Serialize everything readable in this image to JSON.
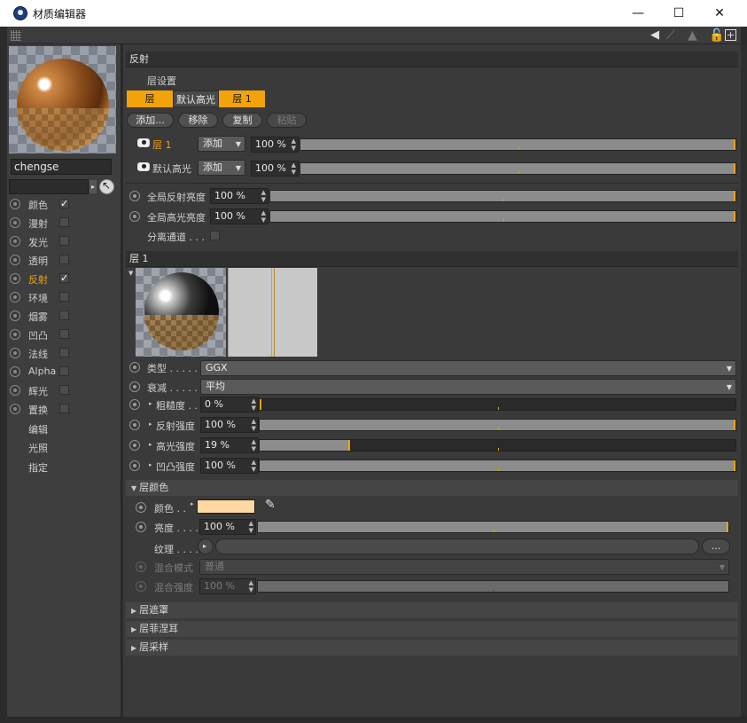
{
  "window": {
    "title": "材质编辑器",
    "minimize": "—",
    "maximize": "☐",
    "close": "✕"
  },
  "colors": {
    "accent": "#f3a30a",
    "layer_color": "#ffd8a0"
  },
  "left": {
    "material_name": "chengse",
    "channels": [
      {
        "label": "颜色",
        "checked": true,
        "active": false
      },
      {
        "label": "漫射",
        "checked": false,
        "active": false
      },
      {
        "label": "发光",
        "checked": false,
        "active": false
      },
      {
        "label": "透明",
        "checked": false,
        "active": false
      },
      {
        "label": "反射",
        "checked": true,
        "active": true
      },
      {
        "label": "环境",
        "checked": false,
        "active": false
      },
      {
        "label": "烟雾",
        "checked": false,
        "active": false
      },
      {
        "label": "凹凸",
        "checked": false,
        "active": false
      },
      {
        "label": "法线",
        "checked": false,
        "active": false
      },
      {
        "label": "Alpha",
        "checked": false,
        "active": false
      },
      {
        "label": "辉光",
        "checked": false,
        "active": false
      },
      {
        "label": "置换",
        "checked": false,
        "active": false
      }
    ],
    "extras": [
      "编辑",
      "光照",
      "指定"
    ]
  },
  "reflect": {
    "section_title": "反射",
    "layer_settings": "层设置",
    "tabs": [
      "层",
      "默认高光",
      "层 1"
    ],
    "buttons": {
      "add": "添加...",
      "remove": "移除",
      "copy": "复制",
      "paste": "粘贴"
    },
    "layers": [
      {
        "name": "层 1",
        "mode": "添加",
        "value": "100 %",
        "fill": 1.0
      },
      {
        "name": "默认高光",
        "mode": "添加",
        "value": "100 %",
        "fill": 1.0
      }
    ],
    "global_reflect_label": "全局反射亮度",
    "global_reflect_value": "100 %",
    "global_spec_label": "全局高光亮度",
    "global_spec_value": "100 %",
    "separate_pass_label": "分离通道 . . ."
  },
  "layer1": {
    "section_title": "层 1",
    "type_label": "类型 . . . . . .",
    "type_value": "GGX",
    "atten_label": "衰减 . . . . . . .",
    "atten_value": "平均",
    "params": [
      {
        "label": "粗糙度 . .",
        "value": "0 %",
        "fill": 0.0
      },
      {
        "label": "反射强度",
        "value": "100 %",
        "fill": 1.0
      },
      {
        "label": "高光强度",
        "value": "19 %",
        "fill": 0.19
      },
      {
        "label": "凹凸强度",
        "value": "100 %",
        "fill": 1.0
      }
    ],
    "color_section": "层颜色",
    "color_label": "颜色 . .",
    "brightness_label": "亮度 . . . .",
    "brightness_value": "100 %",
    "brightness_fill": 1.0,
    "texture_label": "纹理 . . . .",
    "texture_more": "...",
    "blend_mode_label": "混合模式",
    "blend_mode_value": "普通",
    "blend_strength_label": "混合强度",
    "blend_strength_value": "100 %",
    "blend_strength_fill": 1.0,
    "collapsed": [
      "层遮罩",
      "层菲涅耳",
      "层采样"
    ]
  }
}
